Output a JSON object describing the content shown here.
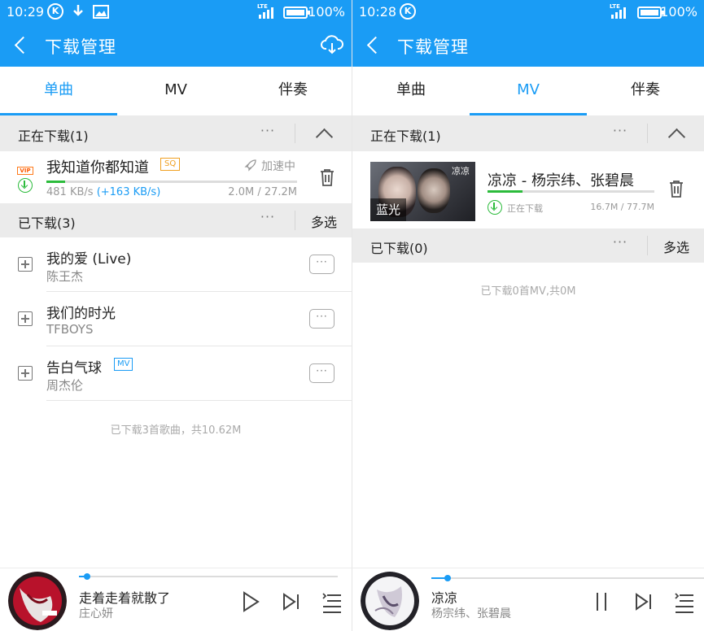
{
  "left": {
    "status": {
      "time": "10:29",
      "network": "LTE",
      "battery": "100%"
    },
    "header": {
      "title": "下载管理"
    },
    "tabs": [
      {
        "label": "单曲",
        "active": true
      },
      {
        "label": "MV",
        "active": false
      },
      {
        "label": "伴奏",
        "active": false
      }
    ],
    "downloading": {
      "section_title": "正在下载(1)",
      "item": {
        "vip": "VIP",
        "title": "我知道你都知道",
        "quality": "SQ",
        "accelerate": "加速中",
        "speed": "481 KB/s",
        "boost": "(+163 KB/s)",
        "size": "2.0M / 27.2M",
        "progress": 0.074
      }
    },
    "downloaded": {
      "section_title": "已下载(3)",
      "multi_select": "多选",
      "items": [
        {
          "title": "我的爱 (Live)",
          "artist": "陈王杰",
          "mv": ""
        },
        {
          "title": "我们的时光",
          "artist": "TFBOYS",
          "mv": ""
        },
        {
          "title": "告白气球",
          "artist": "周杰伦",
          "mv": "MV"
        }
      ],
      "summary": "已下载3首歌曲，共10.62M"
    },
    "player": {
      "title": "走着走着就散了",
      "artist": "庄心妍",
      "progress": 0.03
    }
  },
  "right": {
    "status": {
      "time": "10:28",
      "network": "LTE",
      "battery": "100%"
    },
    "header": {
      "title": "下载管理"
    },
    "tabs": [
      {
        "label": "单曲",
        "active": false
      },
      {
        "label": "MV",
        "active": true
      },
      {
        "label": "伴奏",
        "active": false
      }
    ],
    "downloading": {
      "section_title": "正在下载(1)",
      "item": {
        "title": "凉凉 - 杨宗纬、张碧晨",
        "thumb_badge": "蓝光",
        "thumb_text": "凉凉",
        "status": "正在下载",
        "size": "16.7M / 77.7M",
        "progress": 0.21
      }
    },
    "downloaded": {
      "section_title": "已下载(0)",
      "multi_select": "多选",
      "summary": "已下载0首MV,共0M"
    },
    "player": {
      "title": "凉凉",
      "artist": "杨宗纬、张碧晨",
      "progress": 0.06
    }
  },
  "icons": {
    "back": "chevron-left-icon",
    "cloud": "cloud-download-icon",
    "more": "more-dots-icon",
    "collapse": "chevron-up-icon",
    "add": "add-to-playlist-icon",
    "trash": "trash-icon",
    "play": "play-icon",
    "pause": "pause-icon",
    "next": "skip-next-icon",
    "playlist": "playlist-icon"
  },
  "colors": {
    "accent": "#1a9cf5",
    "progress": "#2bbb3b",
    "vip": "#ff5a00",
    "sq": "#f0a020"
  }
}
